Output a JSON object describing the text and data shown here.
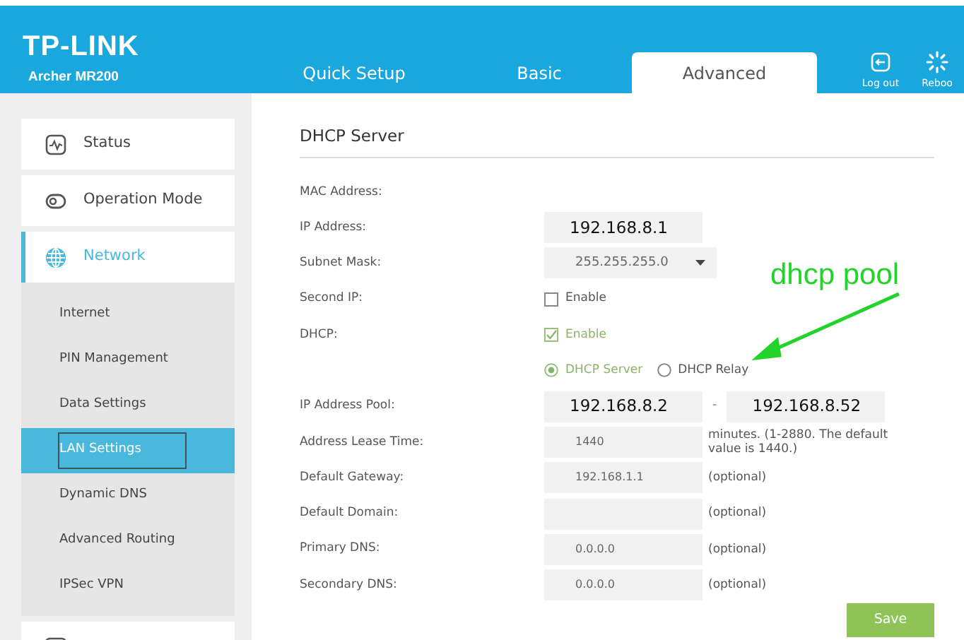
{
  "header": {
    "logo": "TP-LINK",
    "model": "Archer MR200",
    "tabs": [
      {
        "label": "Quick Setup",
        "selected": false
      },
      {
        "label": "Basic",
        "selected": false
      },
      {
        "label": "Advanced",
        "selected": true
      }
    ],
    "actions": [
      {
        "kind": "logout",
        "label": "Log out"
      },
      {
        "kind": "reboot",
        "label": "Reboo"
      }
    ]
  },
  "sidebar": {
    "items": [
      {
        "kind": "status",
        "label": "Status",
        "selected": false
      },
      {
        "kind": "mode",
        "label": "Operation Mode",
        "selected": false
      },
      {
        "kind": "network",
        "label": "Network",
        "selected": true,
        "expanded": true,
        "children": [
          {
            "label": "Internet",
            "selected": false,
            "framed": false
          },
          {
            "label": "PIN Management",
            "selected": false,
            "framed": false
          },
          {
            "label": "Data Settings",
            "selected": false,
            "framed": false
          },
          {
            "label": "LAN Settings",
            "selected": true,
            "framed": true
          },
          {
            "label": "Dynamic DNS",
            "selected": false,
            "framed": false
          },
          {
            "label": "Advanced Routing",
            "selected": false,
            "framed": false
          },
          {
            "label": "IPSec VPN",
            "selected": false,
            "framed": false
          }
        ]
      },
      {
        "kind": "other",
        "selected": false
      }
    ]
  },
  "form": {
    "title": "DHCP Server",
    "rows": [
      {
        "kind": "plain",
        "label": "MAC Address:"
      },
      {
        "kind": "address",
        "label": "IP Address:",
        "value": "192.168.8.1"
      },
      {
        "kind": "select",
        "label": "Subnet Mask:",
        "value": "255.255.255.0"
      },
      {
        "kind": "checkbox",
        "label": "Second IP:",
        "option": "Enable",
        "checked": false
      },
      {
        "kind": "checkbox",
        "label": "DHCP:",
        "option": "Enable",
        "checked": true
      },
      {
        "kind": "radios",
        "options": [
          {
            "label": "DHCP Server",
            "selected": true
          },
          {
            "label": "DHCP Relay",
            "selected": false
          }
        ]
      },
      {
        "kind": "range",
        "label": "IP Address Pool:",
        "from": "192.168.8.2",
        "separator": "-",
        "to": "192.168.8.52"
      },
      {
        "kind": "input",
        "label": "Address Lease Time:",
        "value": "1440",
        "note": "minutes. (1-2880. The default value is 1440.)"
      },
      {
        "kind": "input",
        "label": "Default Gateway:",
        "value": "192.168.1.1",
        "note": "(optional)"
      },
      {
        "kind": "input",
        "label": "Default Domain:",
        "note": "(optional)"
      },
      {
        "kind": "input",
        "label": "Primary DNS:",
        "value": "0.0.0.0",
        "note": "(optional)"
      },
      {
        "kind": "input",
        "label": "Secondary DNS:",
        "value": "0.0.0.0",
        "note": "(optional)"
      }
    ],
    "save": "Save"
  },
  "annotation": {
    "text": "dhcp pool"
  }
}
